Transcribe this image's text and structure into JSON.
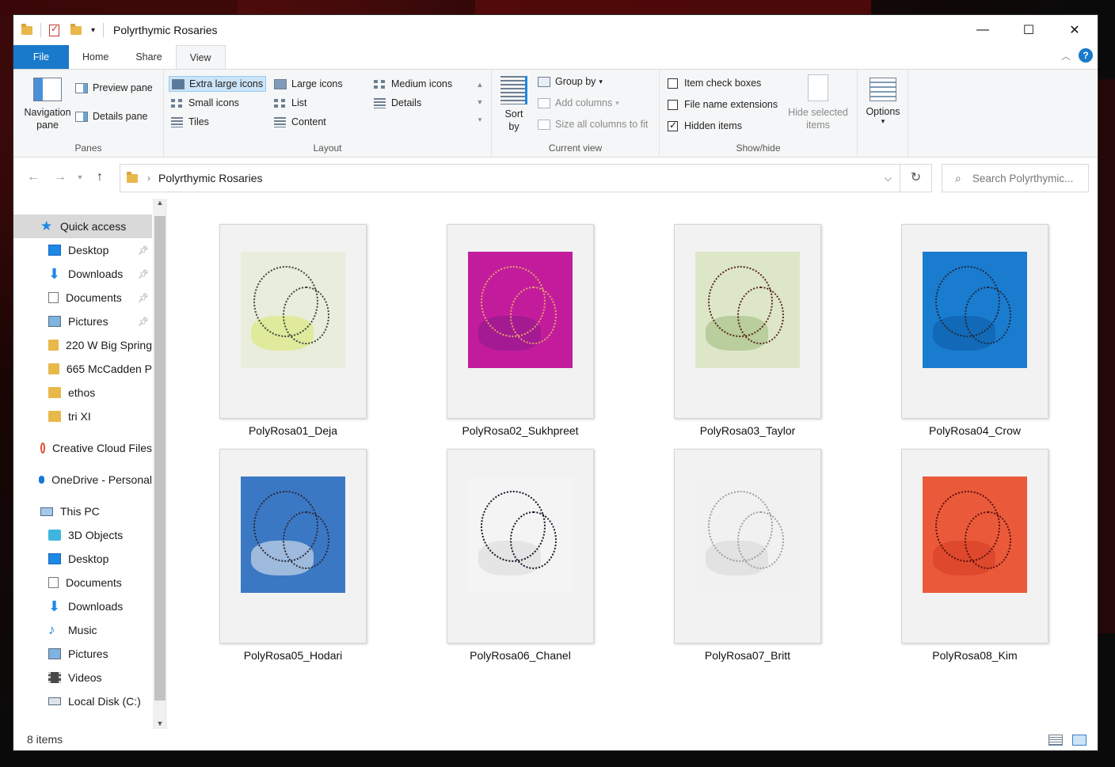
{
  "window": {
    "title": "Polyrthymic Rosaries",
    "controls": {
      "minimize": "—",
      "maximize": "☐",
      "close": "✕"
    }
  },
  "tabs": [
    {
      "label": "File",
      "active": false
    },
    {
      "label": "Home",
      "active": false
    },
    {
      "label": "Share",
      "active": false
    },
    {
      "label": "View",
      "active": true
    }
  ],
  "ribbon": {
    "panes": {
      "label": "Panes",
      "navigation_pane": "Navigation pane",
      "preview_pane": "Preview pane",
      "details_pane": "Details pane"
    },
    "layout": {
      "label": "Layout",
      "options": [
        {
          "label": "Extra large icons",
          "selected": true,
          "icon": "extra-large-icons-icon"
        },
        {
          "label": "Large icons",
          "selected": false,
          "icon": "large-icons-icon"
        },
        {
          "label": "Medium icons",
          "selected": false,
          "icon": "medium-icons-icon"
        },
        {
          "label": "Small icons",
          "selected": false,
          "icon": "small-icons-icon"
        },
        {
          "label": "List",
          "selected": false,
          "icon": "list-icon"
        },
        {
          "label": "Details",
          "selected": false,
          "icon": "details-icon"
        },
        {
          "label": "Tiles",
          "selected": false,
          "icon": "tiles-icon"
        },
        {
          "label": "Content",
          "selected": false,
          "icon": "content-icon"
        }
      ]
    },
    "current_view": {
      "label": "Current view",
      "sort_by": "Sort by",
      "group_by": "Group by",
      "add_columns": "Add columns",
      "size_all_columns": "Size all columns to fit"
    },
    "show_hide": {
      "label": "Show/hide",
      "item_check_boxes": {
        "label": "Item check boxes",
        "checked": false
      },
      "file_name_extensions": {
        "label": "File name extensions",
        "checked": false
      },
      "hidden_items": {
        "label": "Hidden items",
        "checked": true
      },
      "hide_selected": "Hide selected items"
    },
    "options": "Options"
  },
  "address": {
    "path": "Polyrthymic Rosaries",
    "search_placeholder": "Search Polyrthymic..."
  },
  "nav": {
    "quick_access": "Quick access",
    "quick_items": [
      {
        "label": "Desktop",
        "icon": "desktop-icon",
        "pinned": true
      },
      {
        "label": "Downloads",
        "icon": "downloads-icon",
        "pinned": true
      },
      {
        "label": "Documents",
        "icon": "documents-icon",
        "pinned": true
      },
      {
        "label": "Pictures",
        "icon": "pictures-icon",
        "pinned": true
      },
      {
        "label": "220 W Big Spring",
        "icon": "folder-icon",
        "pinned": false
      },
      {
        "label": "665 McCadden P",
        "icon": "folder-icon",
        "pinned": false
      },
      {
        "label": "ethos",
        "icon": "folder-icon",
        "pinned": false
      },
      {
        "label": "tri XI",
        "icon": "folder-icon",
        "pinned": false
      }
    ],
    "creative_cloud": "Creative Cloud Files",
    "onedrive": "OneDrive - Personal",
    "this_pc": "This PC",
    "pc_items": [
      {
        "label": "3D Objects",
        "icon": "3d-objects-icon"
      },
      {
        "label": "Desktop",
        "icon": "desktop-icon"
      },
      {
        "label": "Documents",
        "icon": "documents-icon"
      },
      {
        "label": "Downloads",
        "icon": "downloads-icon"
      },
      {
        "label": "Music",
        "icon": "music-icon"
      },
      {
        "label": "Pictures",
        "icon": "pictures-icon"
      },
      {
        "label": "Videos",
        "icon": "videos-icon"
      },
      {
        "label": "Local Disk (C:)",
        "icon": "local-disk-icon"
      }
    ]
  },
  "files": [
    {
      "name": "PolyRosa01_Deja",
      "paper_color": "#e9eddc",
      "accent": "#d8e86a",
      "bead": "#3a4a3a"
    },
    {
      "name": "PolyRosa02_Sukhpreet",
      "paper_color": "#c21c9c",
      "accent": "#8a1a8a",
      "bead": "#e7a06a"
    },
    {
      "name": "PolyRosa03_Taylor",
      "paper_color": "#dde7c8",
      "accent": "#9ab87a",
      "bead": "#5a2a1a"
    },
    {
      "name": "PolyRosa04_Crow",
      "paper_color": "#1a7ccf",
      "accent": "#0c5aa6",
      "bead": "#1d2b3d"
    },
    {
      "name": "PolyRosa05_Hodari",
      "paper_color": "#3b78c4",
      "accent": "#f0f0f0",
      "bead": "#2a2a3a"
    },
    {
      "name": "PolyRosa06_Chanel",
      "paper_color": "#f4f4f4",
      "accent": "#d8d8d8",
      "bead": "#111827"
    },
    {
      "name": "PolyRosa07_Britt",
      "paper_color": "#f1f1f1",
      "accent": "#d5d5d5",
      "bead": "#9aa0a8"
    },
    {
      "name": "PolyRosa08_Kim",
      "paper_color": "#ea5a3a",
      "accent": "#d33a22",
      "bead": "#5a1010"
    }
  ],
  "status": {
    "count": "8 items"
  }
}
